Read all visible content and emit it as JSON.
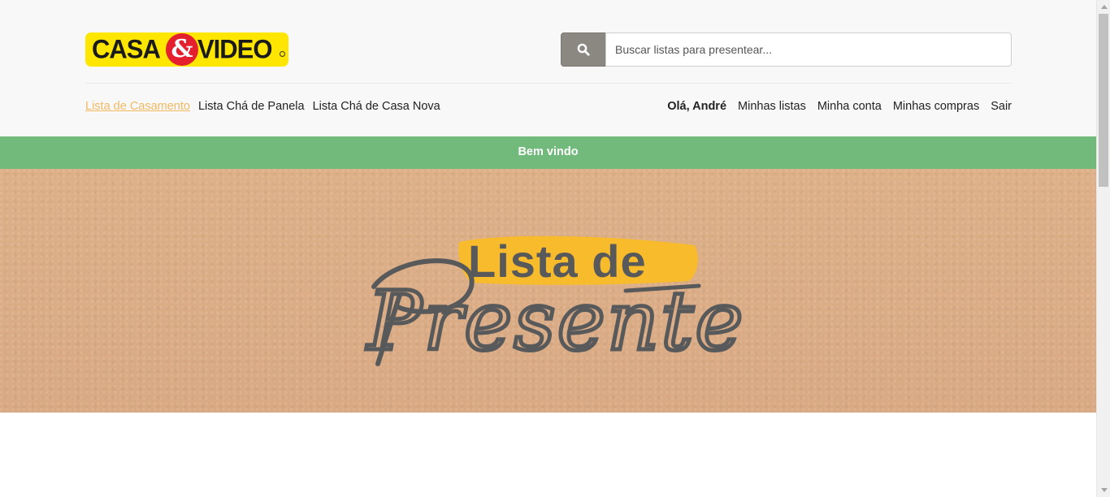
{
  "header": {
    "logo": {
      "word1": "CASA",
      "amp": "&",
      "word2": "VIDEO"
    },
    "search": {
      "placeholder": "Buscar listas para presentear...",
      "value": "",
      "icon": "search-icon"
    }
  },
  "nav_left": [
    {
      "label": "Lista de Casamento",
      "active": true
    },
    {
      "label": "Lista Chá de Panela",
      "active": false
    },
    {
      "label": "Lista Chá de Casa Nova",
      "active": false
    }
  ],
  "nav_right": {
    "greeting": "Olá, André",
    "links": [
      "Minhas listas",
      "Minha conta",
      "Minhas compras",
      "Sair"
    ]
  },
  "welcome_bar": {
    "text": "Bem vindo"
  },
  "hero": {
    "title_line1": "Lista de",
    "title_line2": "Presente"
  },
  "colors": {
    "header_bg": "#f8f8f8",
    "logo_yellow": "#ffe600",
    "logo_red": "#e4202e",
    "active_link": "#f4b860",
    "welcome_green": "#72b97c",
    "hero_kraft": "#dcae86",
    "hero_text": "#58595b",
    "hero_highlight": "#f8bb2c"
  }
}
